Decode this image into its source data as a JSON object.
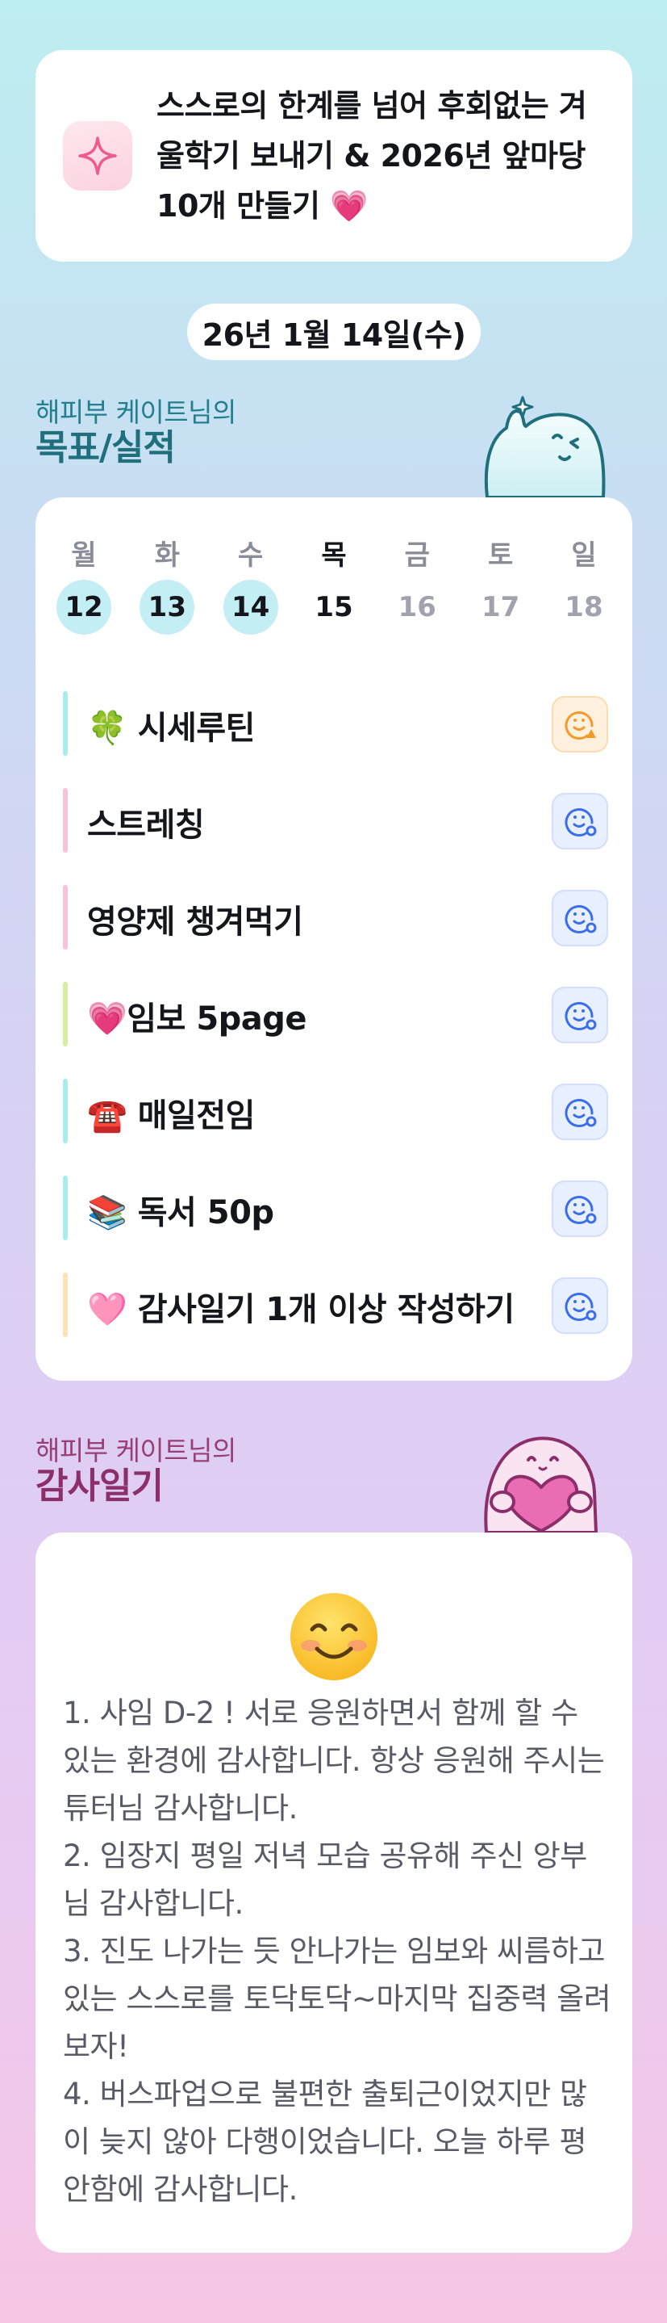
{
  "goal": {
    "icon": "sparkle-icon",
    "text": "스스로의 한계를 넘어 후회없는 겨울학기 보내기 & 2026년 앞마당 10개 만들기 💗"
  },
  "date": "26년 1월 14일(수)",
  "goals_section": {
    "subtitle": "해피부 케이트님의",
    "title": "목표/실적"
  },
  "week": [
    {
      "label": "월",
      "num": "12",
      "state": "done"
    },
    {
      "label": "화",
      "num": "13",
      "state": "done"
    },
    {
      "label": "수",
      "num": "14",
      "state": "done"
    },
    {
      "label": "목",
      "num": "15",
      "state": "today"
    },
    {
      "label": "금",
      "num": "16",
      "state": "future"
    },
    {
      "label": "토",
      "num": "17",
      "state": "future"
    },
    {
      "label": "일",
      "num": "18",
      "state": "future"
    }
  ],
  "tasks": [
    {
      "label": "🍀 시세루틴",
      "bar_color": "#a9ecec",
      "status": "orange"
    },
    {
      "label": "스트레칭",
      "bar_color": "#f7c3dc",
      "status": "blue"
    },
    {
      "label": "영양제 챙겨먹기",
      "bar_color": "#f7c3dc",
      "status": "blue"
    },
    {
      "label": "💗임보 5page",
      "bar_color": "#d5ef9f",
      "status": "blue"
    },
    {
      "label": "☎️ 매일전임",
      "bar_color": "#a9ecec",
      "status": "blue"
    },
    {
      "label": "📚 독서 50p",
      "bar_color": "#a9ecec",
      "status": "blue"
    },
    {
      "label": "🩷 감사일기 1개 이상 작성하기",
      "bar_color": "#fbe3b5",
      "status": "blue"
    }
  ],
  "journal_section": {
    "subtitle": "해피부 케이트님의",
    "title": "감사일기"
  },
  "journal": {
    "emoji": "smiling-face-icon",
    "text": "1. 사임 D-2 ! 서로 응원하면서 함께 할 수 있는 환경에 감사합니다. 항상 응원해 주시는 튜터님 감사합니다.\n2. 임장지 평일 저녁 모습 공유해 주신 앙부님 감사합니다.\n3. 진도 나가는 듯 안나가는 임보와 씨름하고 있는 스스로를 토닥토닥~마지막 집중력 올려보자!\n4. 버스파업으로 불편한 출퇴근이었지만 많이 늦지 않아 다행이었습니다. 오늘 하루 평안함에 감사합니다."
  }
}
